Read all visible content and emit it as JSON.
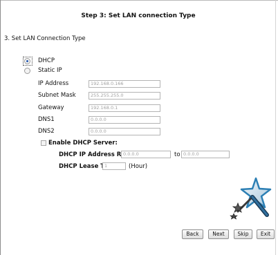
{
  "page": {
    "title": "Step 3: Set LAN connection Type",
    "section_title": "3. Set LAN Connection Type"
  },
  "connection_type": {
    "selected": "DHCP",
    "options": [
      {
        "label": "DHCP",
        "selected": true
      },
      {
        "label": "Static IP",
        "selected": false
      }
    ]
  },
  "static_ip": {
    "ip_address": {
      "label": "IP Address",
      "value": "192.168.0.166"
    },
    "subnet_mask": {
      "label": "Subnet Mask",
      "value": "255.255.255.0"
    },
    "gateway": {
      "label": "Gateway",
      "value": "192.168.0.1"
    },
    "dns1": {
      "label": "DNS1",
      "value": "0.0.0.0"
    },
    "dns2": {
      "label": "DNS2",
      "value": "0.0.0.0"
    }
  },
  "dhcp_server": {
    "enable_label": "Enable DHCP Server:",
    "enabled": false,
    "range_label": "DHCP IP Address Range:",
    "range_start": "0.0.0.0",
    "range_to": "to",
    "range_end": "0.0.0.0",
    "lease_label": "DHCP Lease Time:",
    "lease_value": "1",
    "lease_unit": "(Hour)"
  },
  "buttons": {
    "back": "Back",
    "next": "Next",
    "skip": "Skip",
    "exit": "Exit"
  },
  "icons": {
    "wizard": "magic-wand-stars-icon"
  }
}
